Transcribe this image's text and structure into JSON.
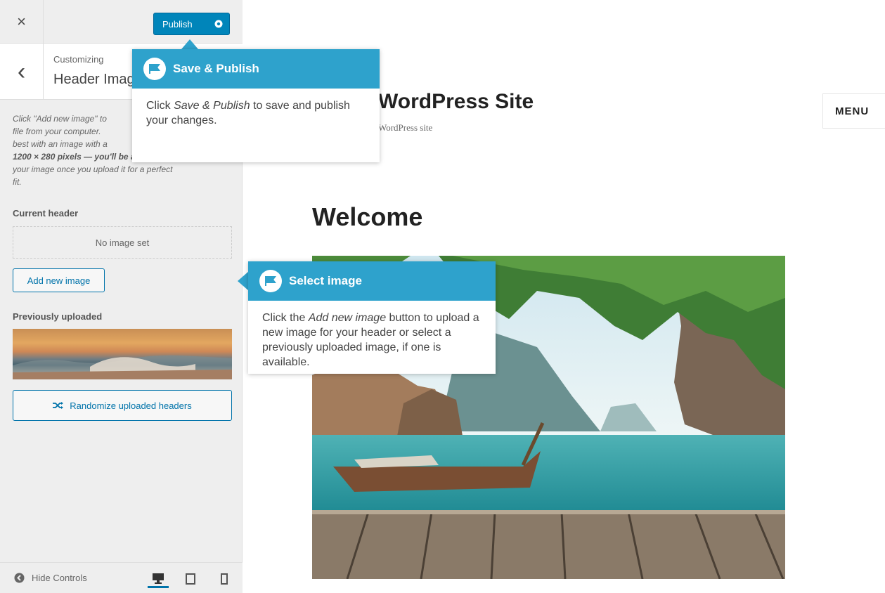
{
  "topbar": {
    "close_icon": "×",
    "publish_label": "Publish"
  },
  "panel": {
    "back_icon": "‹",
    "breadcrumb": "Customizing",
    "title": "Header Image",
    "description_lines": [
      "Click \"Add new image\" to",
      "file from your computer.",
      "best with an image with a",
      "1200 × 280 pixels — you'll be able to crop",
      "your image once you upload it for a perfect",
      "fit."
    ],
    "current_header_label": "Current header",
    "no_image_text": "No image set",
    "add_new_image_label": "Add new image",
    "previously_uploaded_label": "Previously uploaded",
    "randomize_label": "Randomize uploaded headers"
  },
  "footer": {
    "hide_controls_label": "Hide Controls",
    "devices": [
      "desktop",
      "tablet",
      "mobile"
    ],
    "active_device": "desktop"
  },
  "preview": {
    "site_title": "WordPress Site",
    "site_description": "WordPress site",
    "menu_label": "MENU",
    "page_heading": "Welcome"
  },
  "tooltips": {
    "publish": {
      "title": "Save & Publish",
      "body_prefix": "Click ",
      "body_em": "Save & Publish",
      "body_suffix": " to save and publish your changes."
    },
    "select_image": {
      "title": "Select image",
      "body_prefix": "Click the ",
      "body_em": "Add new image",
      "body_suffix": " button to upload a new image for your header or select a previously uploaded image, if one is available."
    }
  },
  "colors": {
    "accent": "#0085ba",
    "link": "#0073aa",
    "tooltip_header": "#2ea2cc",
    "sidebar_bg": "#eeeeee"
  }
}
